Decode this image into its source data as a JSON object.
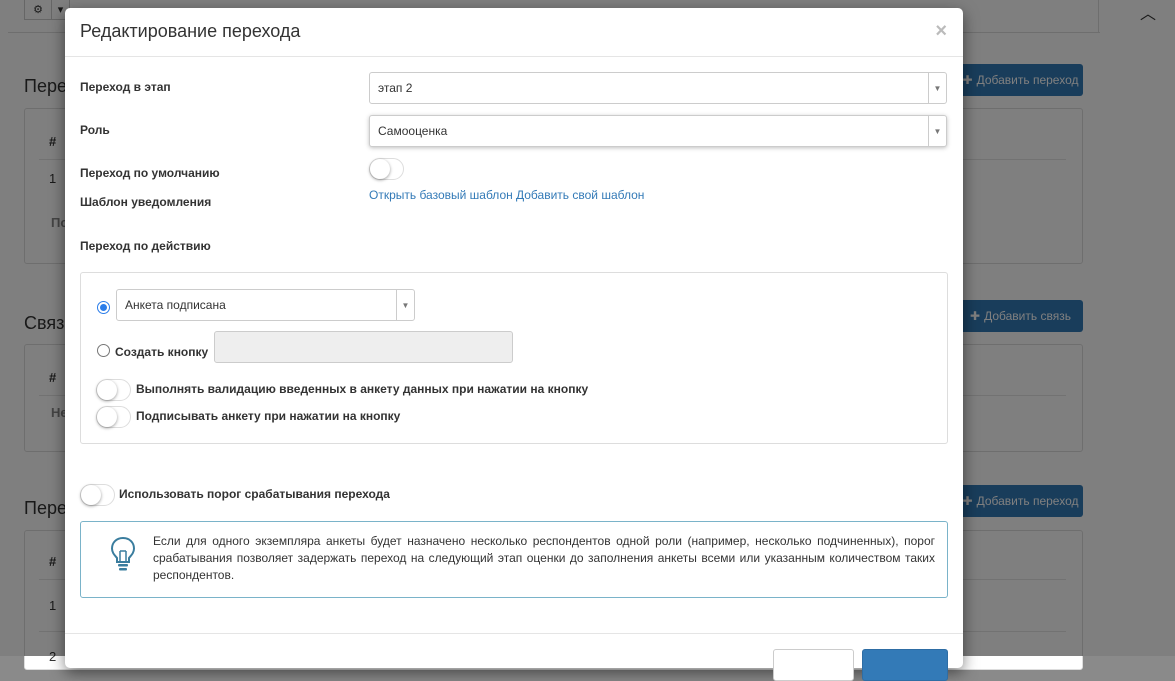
{
  "background": {
    "toolbar": {
      "gear_icon": "⚙",
      "caret_icon": "▾"
    },
    "scroll_arrow": "︿",
    "sections": [
      {
        "title": "Перех",
        "button_label": "Добавить переход",
        "header_col": "#",
        "row_number": "1",
        "footer_text": "По"
      },
      {
        "title": "Связ",
        "button_label": "Добавить связь",
        "header_col": "#",
        "footer_text": "Не"
      },
      {
        "title": "Пере",
        "button_label": "Добавить переход",
        "header_col": "#",
        "row_number": "1",
        "row_number_2": "2"
      }
    ],
    "plus_icon": "✚"
  },
  "modal": {
    "title": "Редактирование перехода",
    "close_label": "×",
    "fields": {
      "stage_label": "Переход в этап",
      "stage_value": "этап 2",
      "role_label": "Роль",
      "role_value": "Самооценка",
      "default_label": "Переход по умолчанию",
      "template_label": "Шаблон уведомления",
      "open_template_link": "Открыть базовый шаблон",
      "add_template_link": "Добавить свой шаблон",
      "action_label": "Переход по действию"
    },
    "action_group": {
      "radio_event_value": "Анкета подписана",
      "radio_button_label": "Создать кнопку",
      "validate_label": "Выполнять валидацию введенных в анкету данных при нажатии на кнопку",
      "sign_label": "Подписывать анкету при нажатии на кнопку"
    },
    "threshold_label": "Использовать порог срабатывания перехода",
    "info_text": "Если для одного экземпляра анкеты будет назначено несколько респондентов одной роли (например, несколько подчиненных), порог срабатывания позволяет задержать переход на следующий этап оценки до заполнения анкеты всеми или указанным количеством таких респондентов.",
    "dropdown_arrow": "▼"
  },
  "colors": {
    "primary": "#337ab7",
    "link": "#337ab7",
    "info_border": "#7ab3c9"
  }
}
